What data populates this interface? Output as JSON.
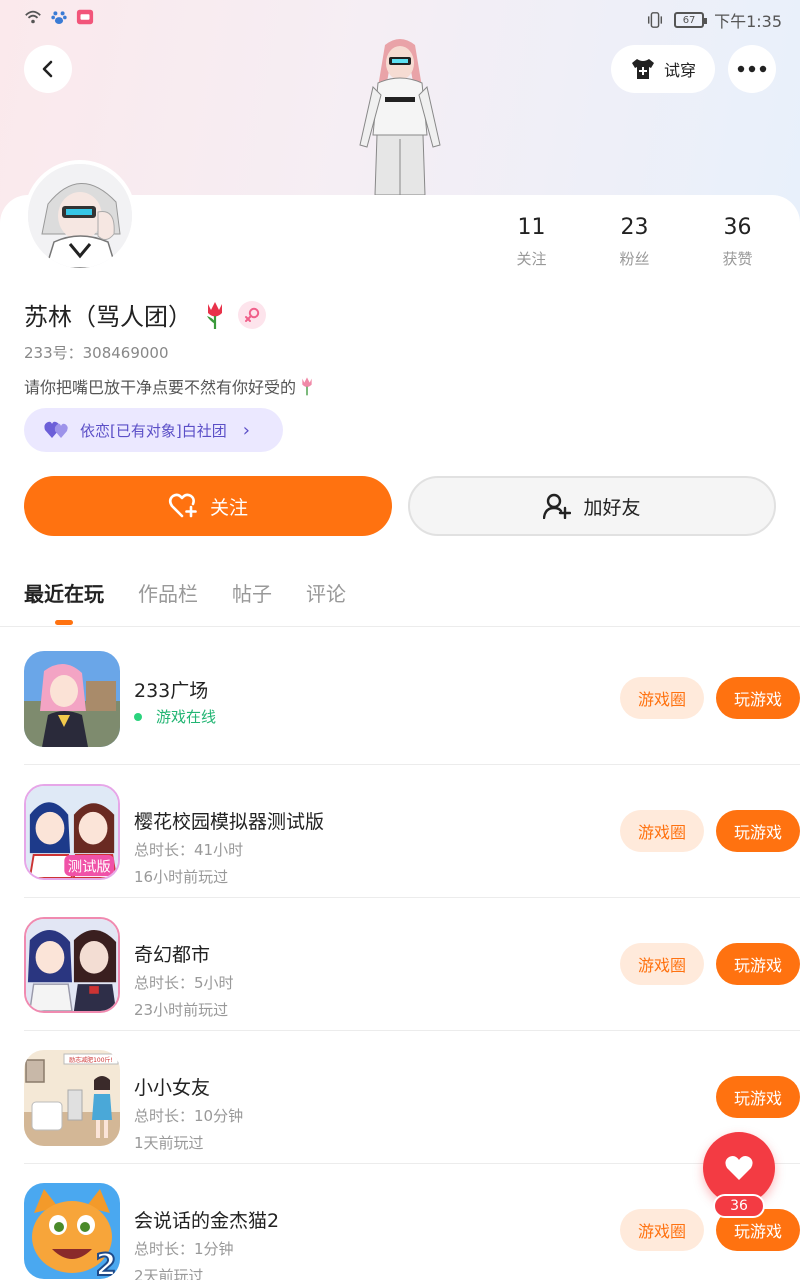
{
  "status_bar": {
    "time": "下午1:35",
    "battery": "67"
  },
  "header": {
    "tryon_label": "试穿"
  },
  "profile": {
    "username": "苏林（骂人团）",
    "account_id": "233号：308469000",
    "bio": "请你把嘴巴放干净点要不然有你好受的",
    "club_tag": "依恋[已有对象]白社团"
  },
  "stats": [
    {
      "value": "11",
      "label": "关注"
    },
    {
      "value": "23",
      "label": "粉丝"
    },
    {
      "value": "36",
      "label": "获赞"
    }
  ],
  "actions": {
    "follow_label": "关注",
    "add_friend_label": "加好友"
  },
  "tabs": [
    {
      "label": "最近在玩"
    },
    {
      "label": "作品栏"
    },
    {
      "label": "帖子"
    },
    {
      "label": "评论"
    }
  ],
  "games": [
    {
      "name": "233广场",
      "line1": "游戏在线",
      "line2": "",
      "circle_label": "游戏圈",
      "play_label": "玩游戏"
    },
    {
      "name": "樱花校园模拟器测试版",
      "line1": "总时长：41小时",
      "line2": "16小时前玩过",
      "circle_label": "游戏圈",
      "play_label": "玩游戏",
      "icon_text": "测试版"
    },
    {
      "name": "奇幻都市",
      "line1": "总时长：5小时",
      "line2": "23小时前玩过",
      "circle_label": "游戏圈",
      "play_label": "玩游戏"
    },
    {
      "name": "小小女友",
      "line1": "总时长：10分钟",
      "line2": "1天前玩过",
      "play_label": "玩游戏",
      "icon_text": "励志减肥100斤!"
    },
    {
      "name": "会说话的金杰猫2",
      "line1": "总时长：1分钟",
      "line2": "2天前玩过",
      "circle_label": "游戏圈",
      "play_label": "玩游戏",
      "icon_text": "2"
    }
  ],
  "like_fab": {
    "count": "36"
  },
  "colors": {
    "accent": "#ff7210",
    "like": "#f33b43",
    "club": "#5b4fc7",
    "online": "#2bd37d"
  }
}
